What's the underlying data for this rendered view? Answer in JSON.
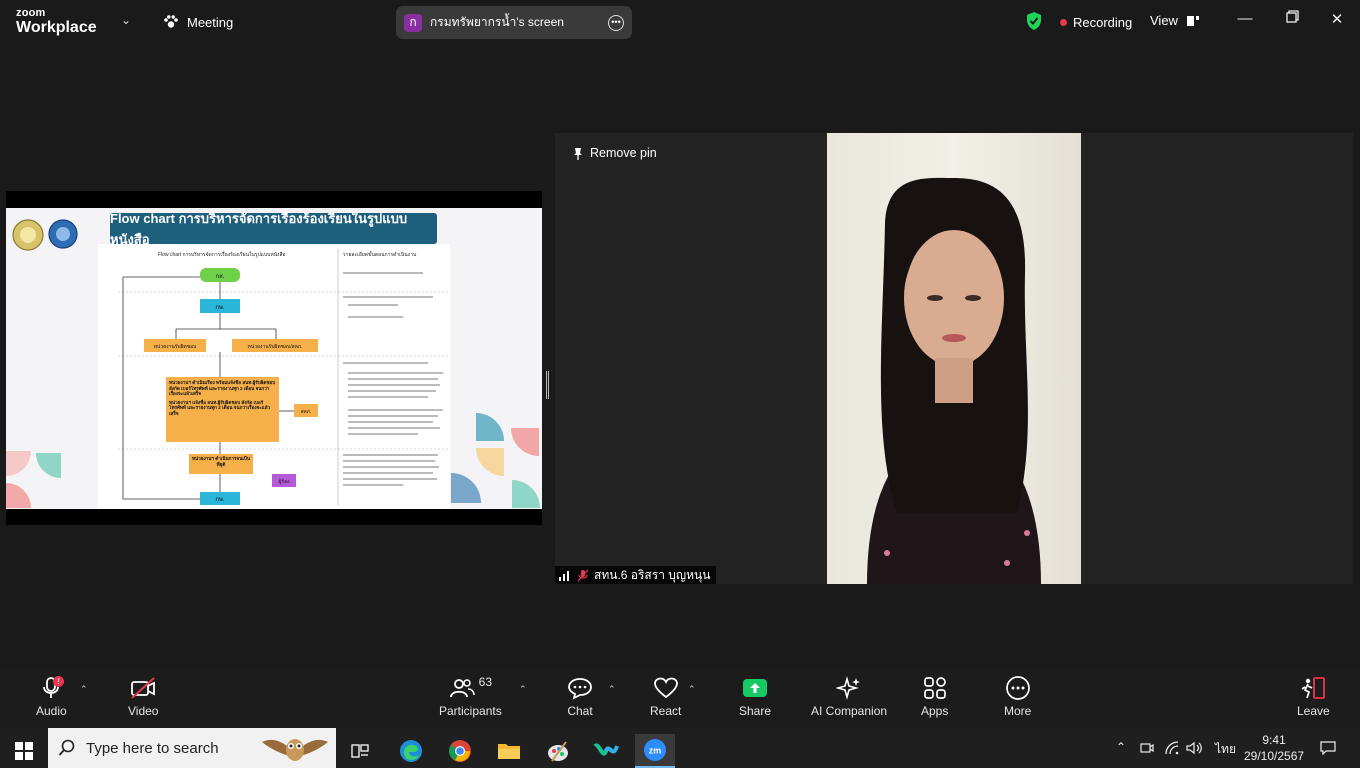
{
  "app": {
    "brand_top": "zoom",
    "brand_bottom": "Workplace",
    "meeting_label": "Meeting"
  },
  "share": {
    "badge": "ก",
    "title": "กรมทรัพยากรน้ำ's screen"
  },
  "status": {
    "recording": "Recording",
    "view": "View"
  },
  "slide": {
    "title": "Flow chart การบริหารจัดการเรื่องร้องเรียนในรูปแบบหนังสือ",
    "doc_heading": "Flow chart การบริหารจัดการเรื่องร้องเรียนในรูปแบบหนังสือ",
    "right_heading": "รายละเอียดขั้นตอนการดำเนินงาน",
    "boxes": {
      "top": "กส.",
      "second": "กษ.",
      "left_unit": "หน่วยงานรับผิดชอบ",
      "right_unit": "หน่วยงานรับผิดชอบ/สลภ.",
      "middle1": "หน่วยงานฯ ดำเนินเรื่อง พร้อมแจ้งชื่อ ลนท.ผู้รับผิดชอบ สังกัด เบอร์โทรศัพท์ และรายงานทุก 2 เดือน จนกว่าเรื่องจะแล้วเสร็จ",
      "middle2": "หน่วยงานฯ แจ้งชื่อ ลนท.ผู้รับผิดชอบ สังกัด เบอร์โทรศัพท์ และรายงานทุก 2 เดือน จนกว่าเรื่องจะแล้วเสร็จ",
      "side": "สลภ.",
      "lower": "หน่วยงานฯ ดำเนินการจนเป็นที่ยุติ",
      "bottom": "กษ.",
      "purple": "ผู้ร้อง"
    }
  },
  "tile": {
    "remove_pin": "Remove pin",
    "participant": "สทน.6 อริสรา บุญหนุน"
  },
  "toolbar": {
    "audio": "Audio",
    "video": "Video",
    "participants": "Participants",
    "participants_count": "63",
    "chat": "Chat",
    "react": "React",
    "share": "Share",
    "ai": "AI Companion",
    "apps": "Apps",
    "more": "More",
    "leave": "Leave",
    "audio_badge": "!"
  },
  "taskbar": {
    "search_placeholder": "Type here to search",
    "lang": "ไทย",
    "time": "9:41",
    "date": "29/10/2567"
  },
  "colors": {
    "accent_green": "#1fd35a",
    "record_red": "#e8384f",
    "share_green": "#17c964",
    "leave_red": "#e8384f",
    "slide_title_bg": "#1e5f7e"
  }
}
